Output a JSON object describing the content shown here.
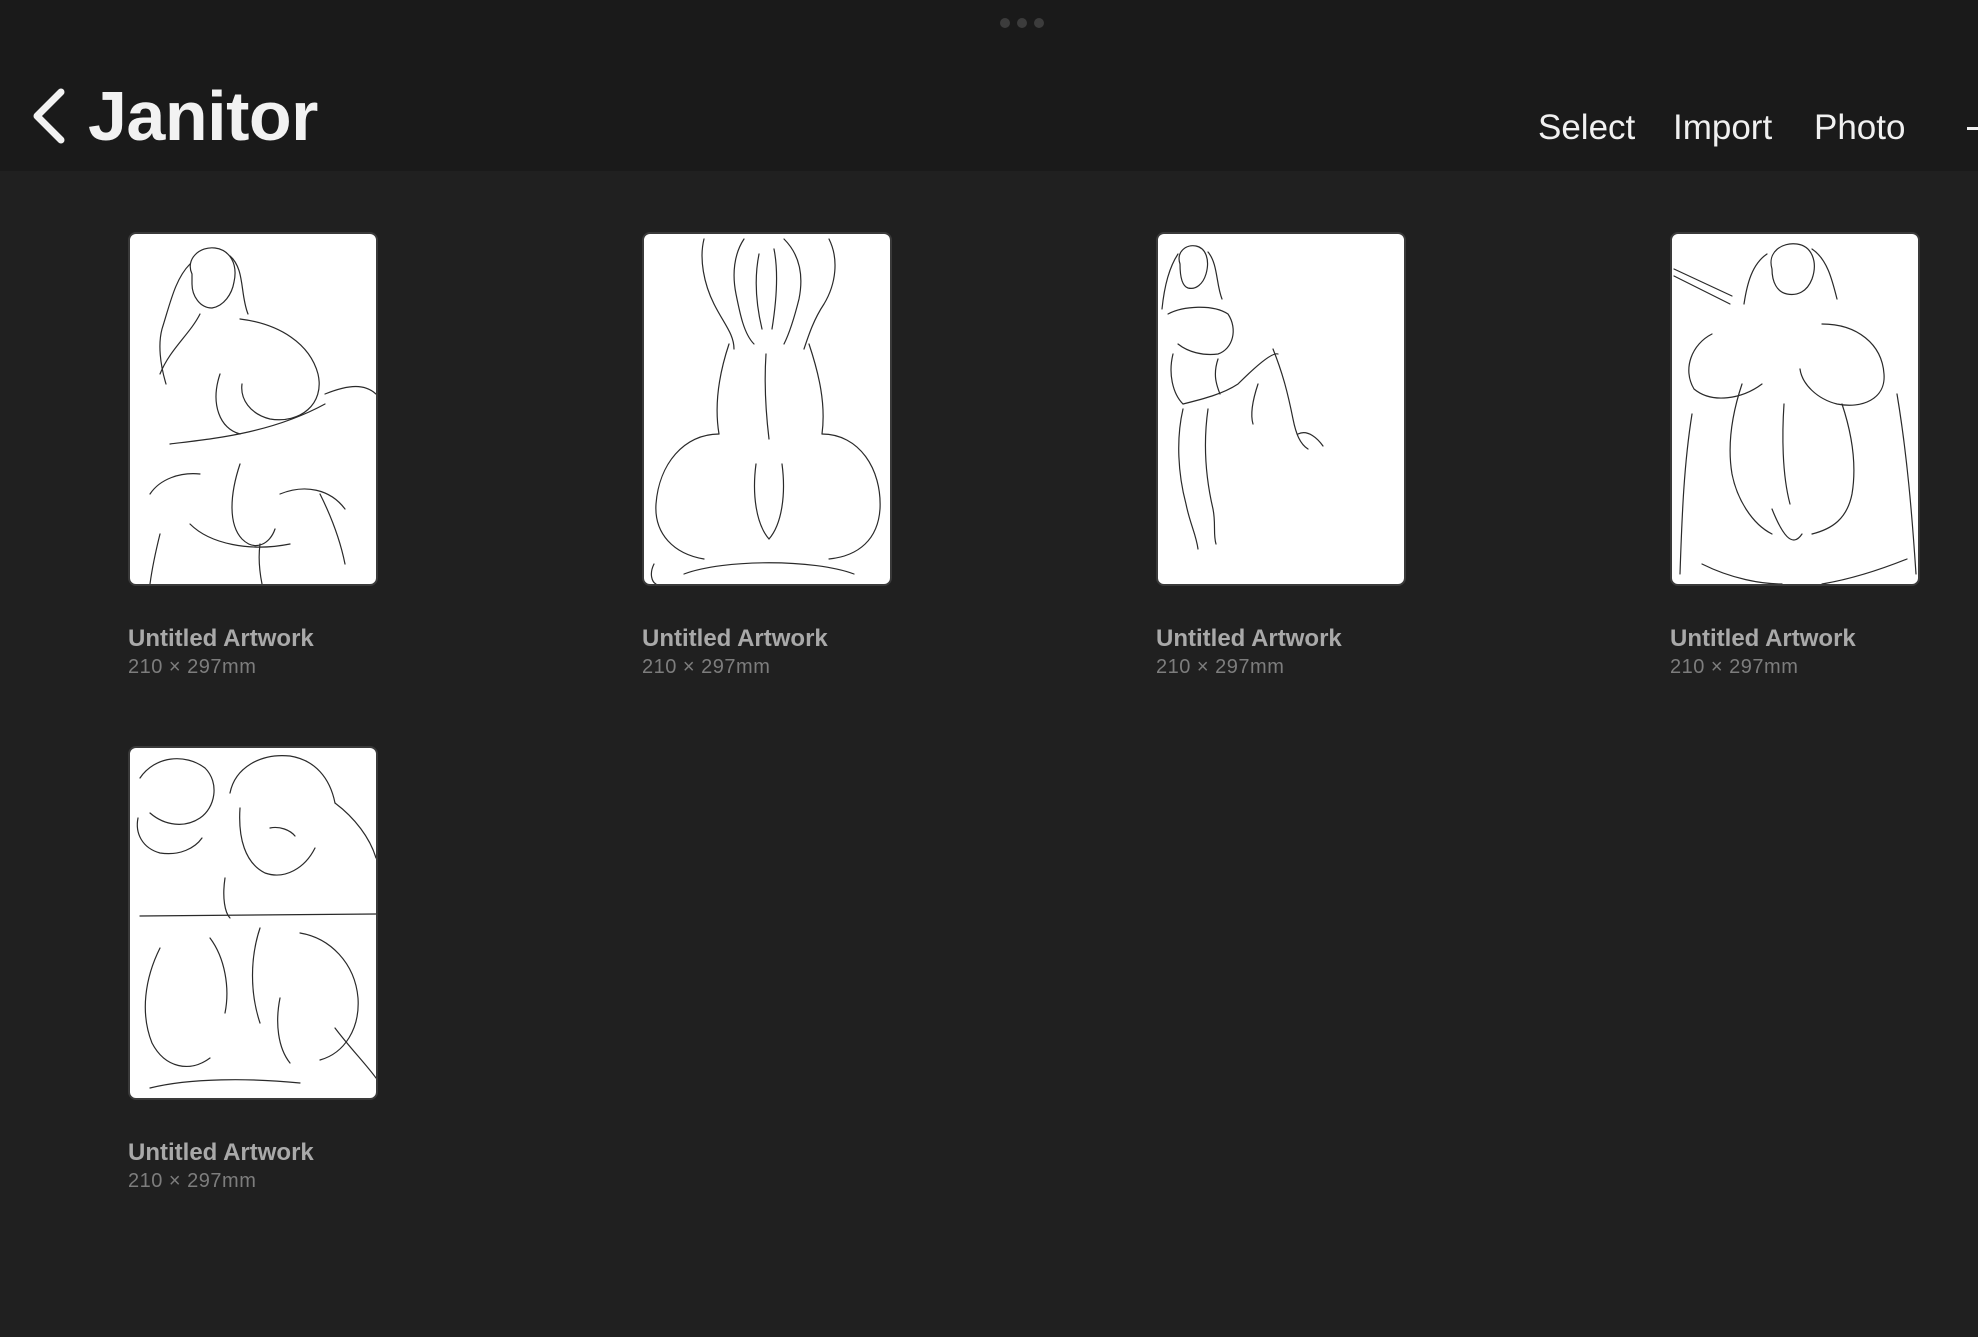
{
  "header": {
    "title": "Janitor",
    "actions": {
      "select": "Select",
      "import": "Import",
      "photo": "Photo"
    }
  },
  "artworks": [
    {
      "title": "Untitled Artwork",
      "size": "210 × 297mm",
      "thumbnail": "line sketch of standing figure, seen from below"
    },
    {
      "title": "Untitled Artwork",
      "size": "210 × 297mm",
      "thumbnail": "line sketch of figure seen from behind, arms raised"
    },
    {
      "title": "Untitled Artwork",
      "size": "210 × 297mm",
      "thumbnail": "line sketch of figure with raised leg"
    },
    {
      "title": "Untitled Artwork",
      "size": "210 × 297mm",
      "thumbnail": "line sketch of figure seen from below holding a sword"
    },
    {
      "title": "Untitled Artwork",
      "size": "210 × 297mm",
      "thumbnail": "line sketch of two-panel composition with older man"
    }
  ],
  "colors": {
    "background": "#202020",
    "topbar": "#1a1a1a",
    "title_text": "#f2f2f2",
    "card_title": "#a9a9a9",
    "card_size": "#7d7d7d"
  }
}
